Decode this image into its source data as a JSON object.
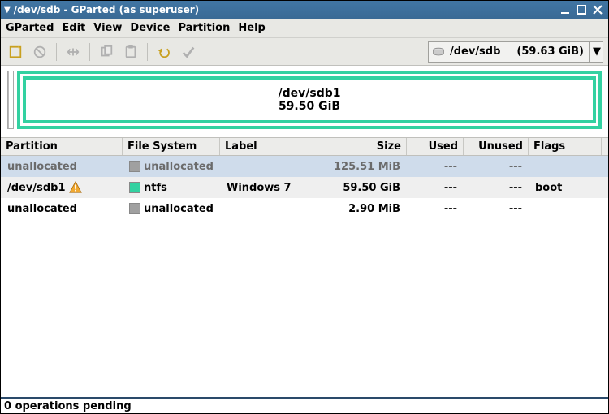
{
  "titlebar": {
    "text": "/dev/sdb - GParted (as superuser)"
  },
  "menubar": {
    "items": [
      {
        "label": "GParted",
        "u": "G"
      },
      {
        "label": "Edit",
        "u": "E"
      },
      {
        "label": "View",
        "u": "V"
      },
      {
        "label": "Device",
        "u": "D"
      },
      {
        "label": "Partition",
        "u": "P"
      },
      {
        "label": "Help",
        "u": "H"
      }
    ]
  },
  "device_select": {
    "path": "/dev/sdb",
    "size": "(59.63 GiB)"
  },
  "diagram": {
    "name": "/dev/sdb1",
    "size": "59.50 GiB"
  },
  "table": {
    "headers": [
      "Partition",
      "File System",
      "Label",
      "Size",
      "Used",
      "Unused",
      "Flags"
    ],
    "rows": [
      {
        "partition": "unallocated",
        "warn": false,
        "fs": "unallocated",
        "fs_color": "sw-unalloc",
        "label": "",
        "size": "125.51 MiB",
        "used": "---",
        "unused": "---",
        "flags": ""
      },
      {
        "partition": "/dev/sdb1",
        "warn": true,
        "fs": "ntfs",
        "fs_color": "sw-ntfs",
        "label": "Windows 7",
        "size": "59.50 GiB",
        "used": "---",
        "unused": "---",
        "flags": "boot"
      },
      {
        "partition": "unallocated",
        "warn": false,
        "fs": "unallocated",
        "fs_color": "sw-unalloc",
        "label": "",
        "size": "2.90 MiB",
        "used": "---",
        "unused": "---",
        "flags": ""
      }
    ]
  },
  "status": {
    "text": "0 operations pending"
  }
}
